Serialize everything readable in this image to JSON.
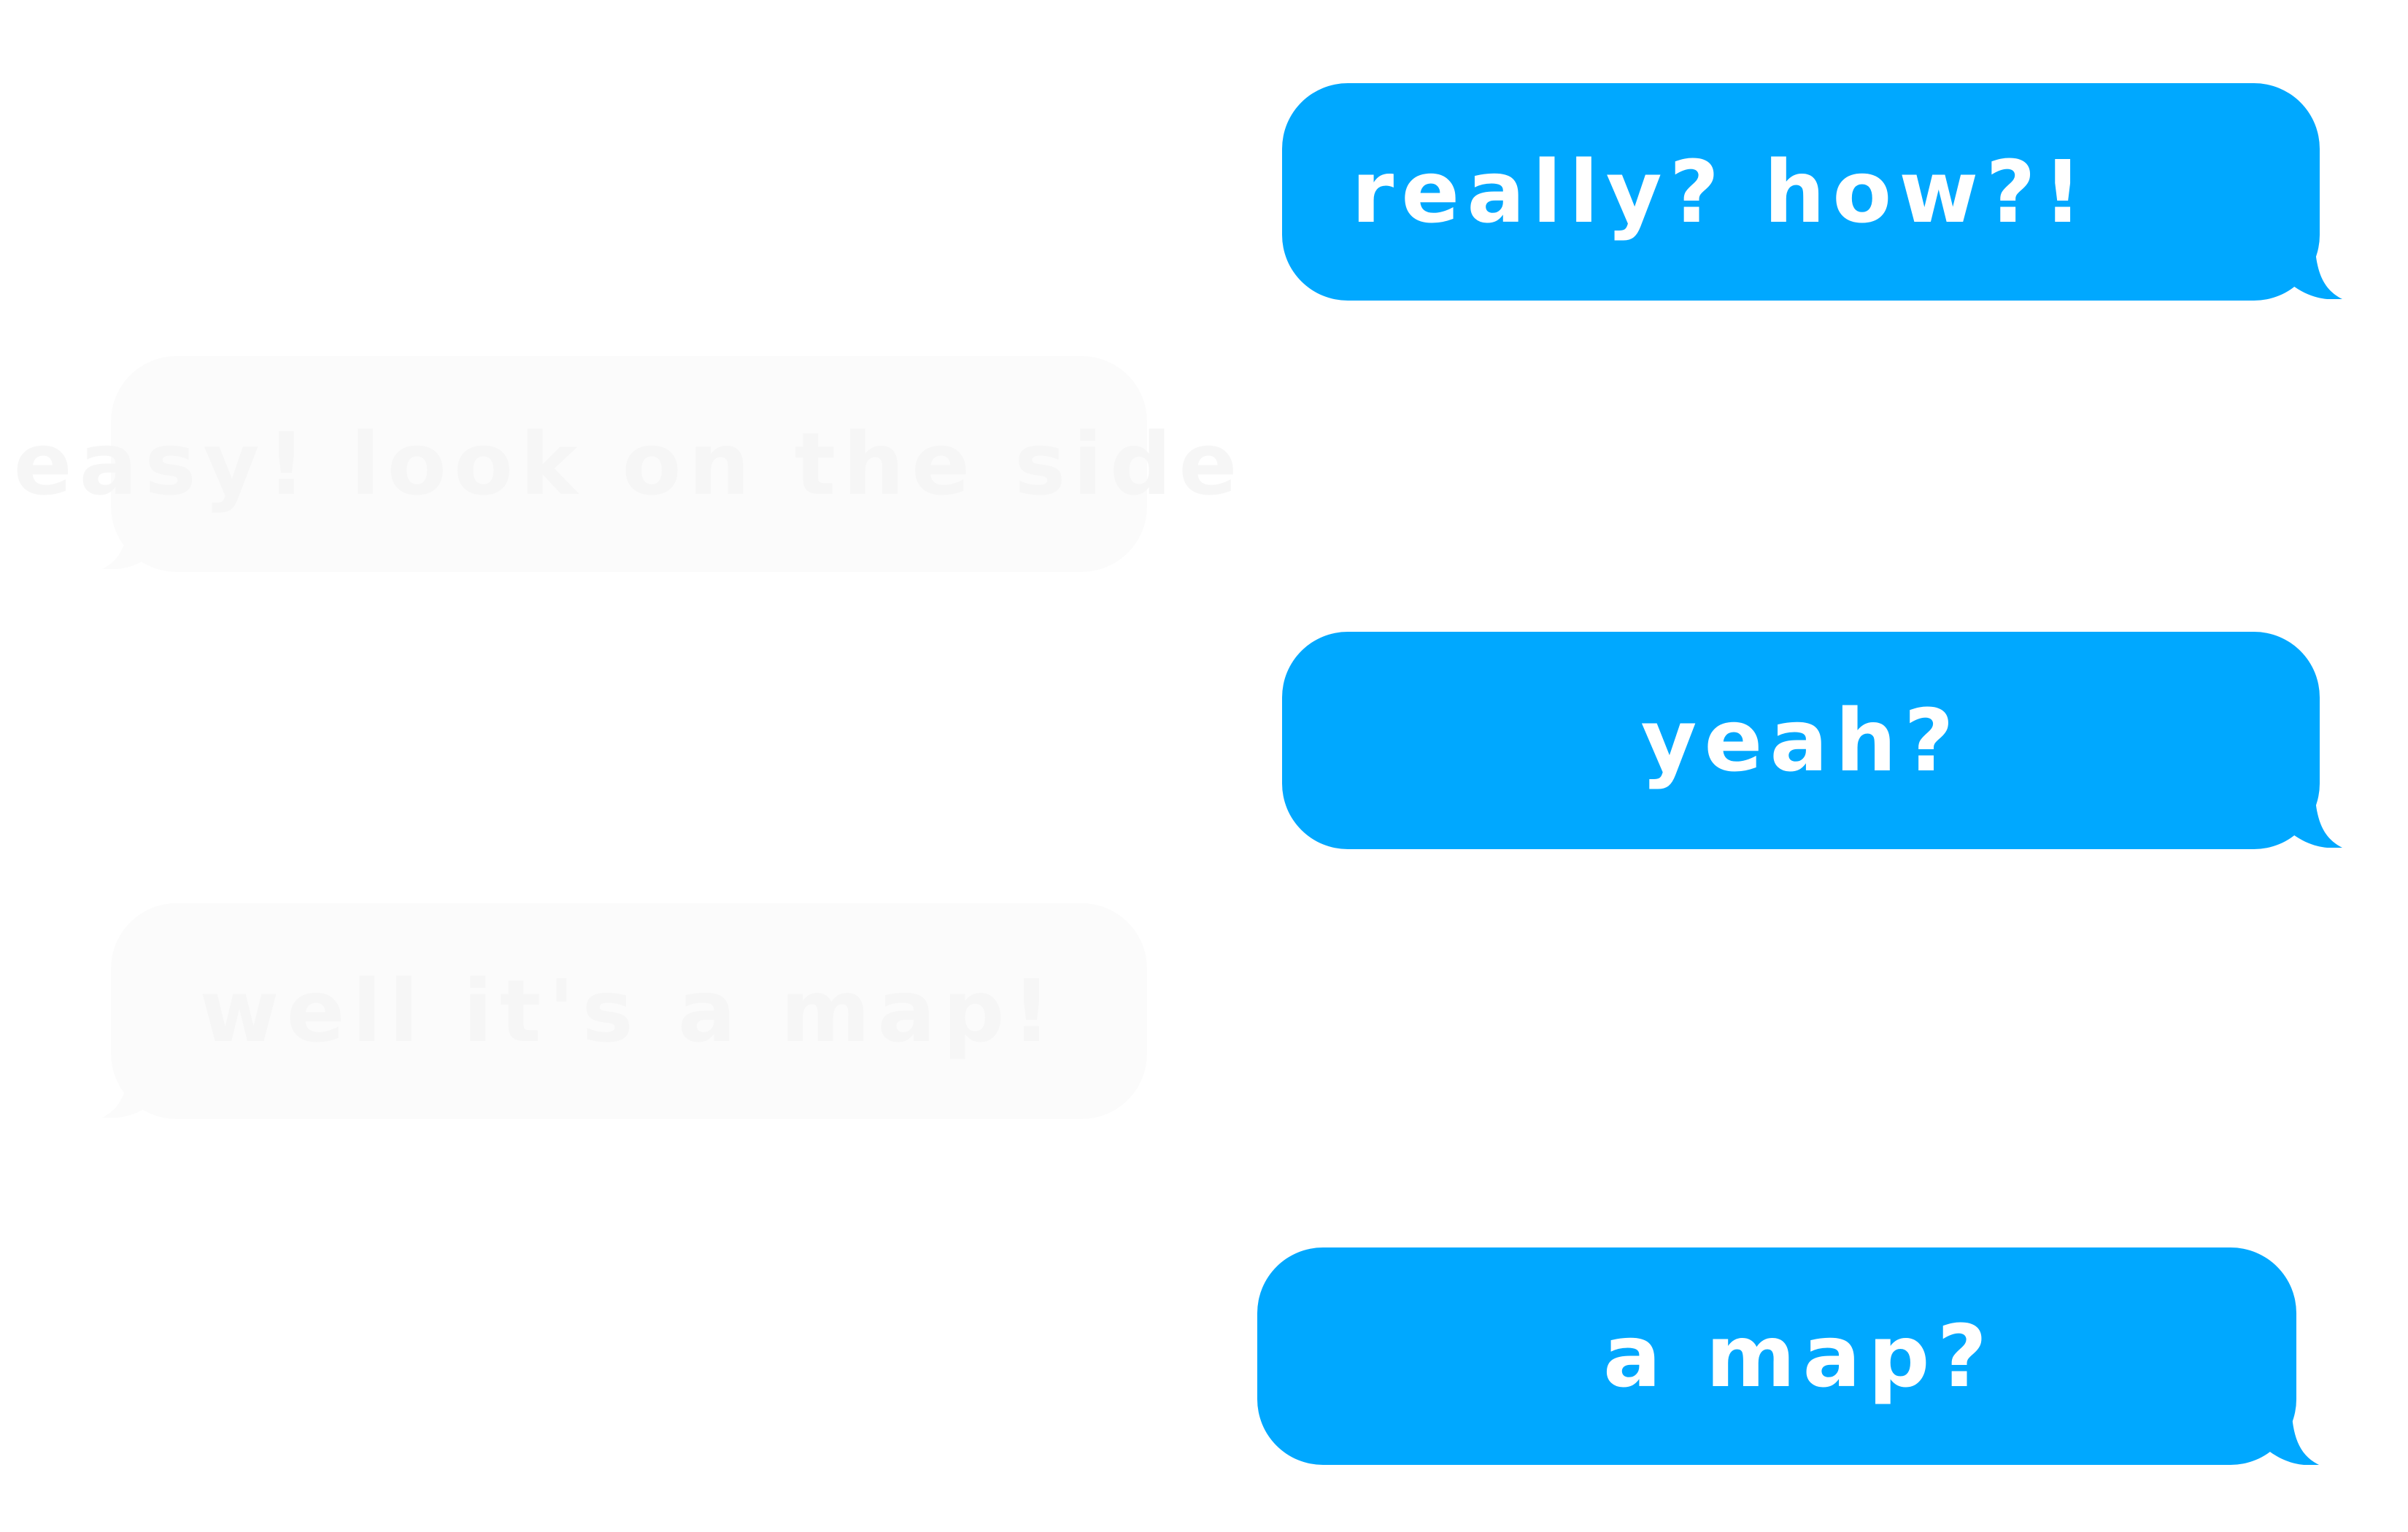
{
  "colors": {
    "sent_bubble": "#00a8ff",
    "sent_text": "#ffffff",
    "received_bubble": "#fbfbfb",
    "received_text": "#f6f6f6",
    "background": "#ffffff"
  },
  "messages": [
    {
      "direction": "sent",
      "text": "really? how?!"
    },
    {
      "direction": "received",
      "text": "easy! look on the side"
    },
    {
      "direction": "sent",
      "text": "yeah?"
    },
    {
      "direction": "received",
      "text": "well it's a map!"
    },
    {
      "direction": "sent",
      "text": "a map?"
    }
  ]
}
